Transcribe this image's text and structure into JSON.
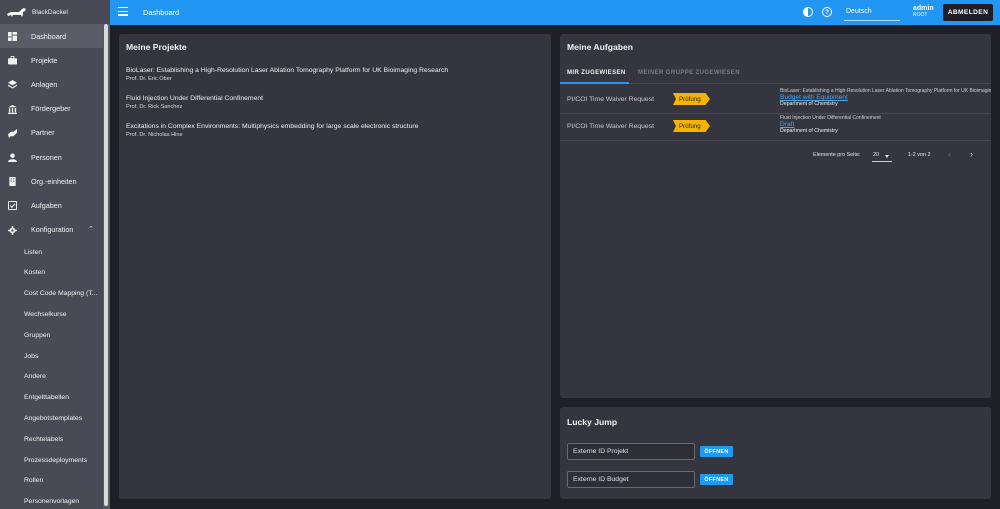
{
  "app": {
    "brand": "BlackDackel"
  },
  "sidebar": {
    "items": [
      {
        "label": "Dashboard",
        "icon": "dashboard-icon",
        "active": true
      },
      {
        "label": "Projekte",
        "icon": "briefcase-icon"
      },
      {
        "label": "Anlagen",
        "icon": "stack-icon"
      },
      {
        "label": "Fördergeber",
        "icon": "bank-icon"
      },
      {
        "label": "Partner",
        "icon": "handshake-icon"
      },
      {
        "label": "Personen",
        "icon": "person-icon"
      },
      {
        "label": "Org.-einheiten",
        "icon": "building-icon"
      },
      {
        "label": "Aufgaben",
        "icon": "checkbox-icon"
      },
      {
        "label": "Konfiguration",
        "icon": "gear-icon",
        "expanded": true
      }
    ],
    "sub_items": [
      "Listen",
      "Kosten",
      "Cost Code Mapping (T...",
      "Wechselkurse",
      "Gruppen",
      "Jobs",
      "Andere",
      "Entgelttabellen",
      "Angebotstemplates",
      "Rechtelabels",
      "Prozessdeployments",
      "Rollen",
      "Personenvorlagen"
    ]
  },
  "topbar": {
    "title": "Dashboard",
    "language": "Deutsch",
    "user_name": "admin",
    "user_role": "ROOT",
    "logout_label": "ABMELDEN",
    "accent_color": "#2196f3"
  },
  "projects_card": {
    "title": "Meine Projekte",
    "projects": [
      {
        "title": "BioLaser: Establishing a High-Resolution Laser Ablation Tomography Platform for UK Bioimaging Research",
        "pi": "Prof. Dr. Eric Ober"
      },
      {
        "title": "Fluid Injection Under Differential Confinement",
        "pi": "Prof. Dr. Rick Sanchez"
      },
      {
        "title": "Excitations in Complex Environments: Multiphysics embedding for large scale electronic structure",
        "pi": "Prof. Dr. Nicholas Hine"
      }
    ]
  },
  "tasks_card": {
    "title": "Meine Aufgaben",
    "tabs": [
      {
        "label": "MIR ZUGEWIESEN",
        "active": true
      },
      {
        "label": "MEINER GRUPPE ZUGEWIESEN",
        "active": false
      }
    ],
    "tasks": [
      {
        "name": "PI/COI Time Waiver Request",
        "status": "Prüfung",
        "project": "BioLaser: Establishing a High-Resolution Laser Ablation Tomography Platform for UK Bioimaging Research",
        "link": "Budget with Equipment",
        "department": "Department of Chemistry"
      },
      {
        "name": "PI/COI Time Waiver Request",
        "status": "Prüfung",
        "project": "Fluid Injection Under Differential Confinement",
        "link": "Draft",
        "department": "Department of Chemistry"
      }
    ],
    "pager": {
      "label": "Elemente pro Seite:",
      "page_size": "20",
      "range": "1-2 von 2"
    },
    "badge_color": "#f5b400"
  },
  "lucky_jump": {
    "title": "Lucky Jump",
    "fields": [
      {
        "placeholder": "Externe ID Projekt",
        "button": "ÖFFNEN"
      },
      {
        "placeholder": "Externe ID Budget",
        "button": "ÖFFNEN"
      }
    ]
  }
}
